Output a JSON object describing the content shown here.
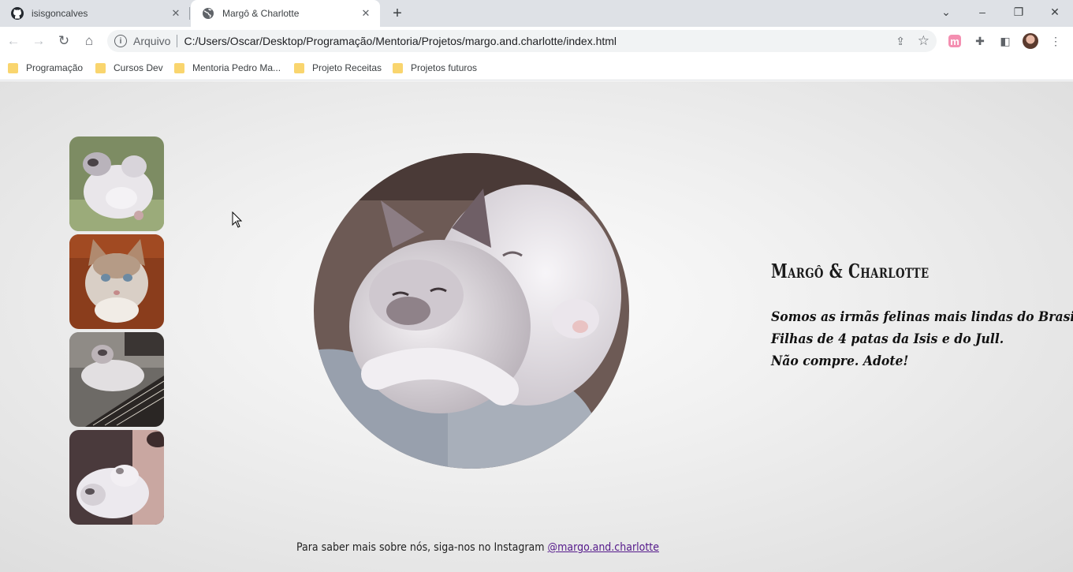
{
  "browser": {
    "tabs": [
      {
        "title": "isisgoncalves",
        "icon": "github-icon"
      },
      {
        "title": "Margô & Charlotte",
        "icon": "globe-icon"
      }
    ],
    "address": {
      "chip": "Arquivo",
      "url": "C:/Users/Oscar/Desktop/Programação/Mentoria/Projetos/margo.and.charlotte/index.html"
    },
    "bookmarks": [
      "Programação",
      "Cursos Dev",
      "Mentoria Pedro Ma...",
      "Projeto Receitas",
      "Projetos futuros"
    ]
  },
  "page": {
    "title": "Margô & Charlotte",
    "description": [
      "Somos as irmãs felinas mais lindas do Brasil.",
      "Filhas de 4 patas da Isis e do Jull.",
      "Não compre. Adote!"
    ],
    "footer_text": "Para saber mais sobre nós, siga-nos no Instagram ",
    "instagram_link": "@margo.and.charlotte"
  },
  "colors": {
    "tabstrip": "#dee1e6",
    "link": "#551a8b",
    "bookmark_folder": "#f9d56e"
  }
}
